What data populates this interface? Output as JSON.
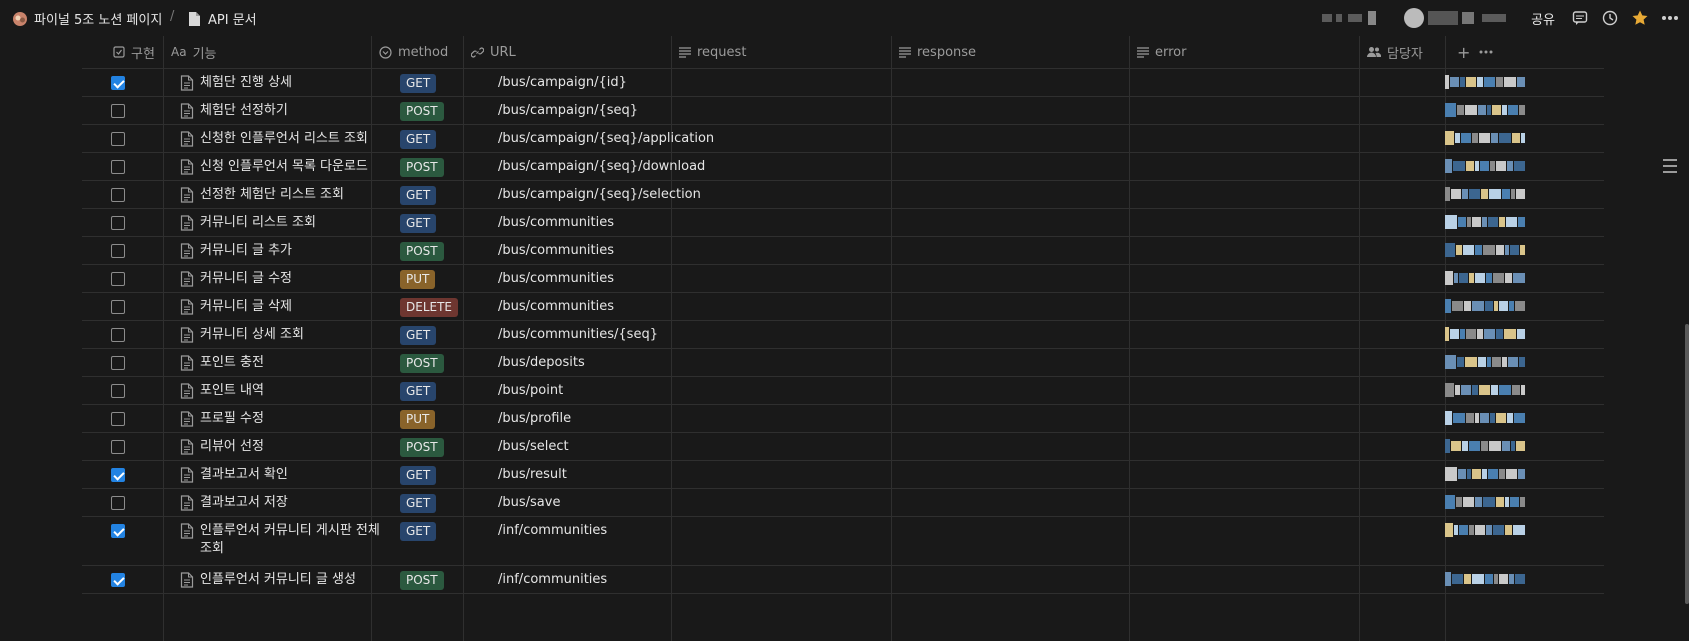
{
  "breadcrumb": {
    "workspace": "파이널 5조 노션 페이지",
    "separator": "/",
    "page": "API 문서"
  },
  "topbar": {
    "share_label": "공유"
  },
  "columns": {
    "done": "구현",
    "feature": "기능",
    "method": "method",
    "url": "URL",
    "request": "request",
    "response": "response",
    "error": "error",
    "assignee": "담당자"
  },
  "colors": {
    "GET": "#28456c",
    "POST": "#2b593f",
    "PUT": "#89632a",
    "DELETE": "#6e3630",
    "checkbox": "#2383e2"
  },
  "rows": [
    {
      "done": true,
      "name": "체험단 진행 상세",
      "method": "GET",
      "url": "/bus/campaign/{id}"
    },
    {
      "done": false,
      "name": "체험단 선정하기",
      "method": "POST",
      "url": "/bus/campaign/{seq}"
    },
    {
      "done": false,
      "name": "신청한 인플루언서 리스트 조회",
      "method": "GET",
      "url": "/bus/campaign/{seq}/application"
    },
    {
      "done": false,
      "name": "신청 인플루언서 목록 다운로드",
      "method": "POST",
      "url": "/bus/campaign/{seq}/download"
    },
    {
      "done": false,
      "name": "선정한 체험단 리스트 조회",
      "method": "GET",
      "url": "/bus/campaign/{seq}/selection"
    },
    {
      "done": false,
      "name": "커뮤니티 리스트 조회",
      "method": "GET",
      "url": "/bus/communities"
    },
    {
      "done": false,
      "name": "커뮤니티 글 추가",
      "method": "POST",
      "url": "/bus/communities"
    },
    {
      "done": false,
      "name": "커뮤니티 글 수정",
      "method": "PUT",
      "url": "/bus/communities"
    },
    {
      "done": false,
      "name": "커뮤니티 글 삭제",
      "method": "DELETE",
      "url": "/bus/communities"
    },
    {
      "done": false,
      "name": "커뮤니티 상세 조회",
      "method": "GET",
      "url": "/bus/communities/{seq}"
    },
    {
      "done": false,
      "name": "포인트 충전",
      "method": "POST",
      "url": "/bus/deposits"
    },
    {
      "done": false,
      "name": "포인트 내역",
      "method": "GET",
      "url": "/bus/point"
    },
    {
      "done": false,
      "name": "프로필 수정",
      "method": "PUT",
      "url": "/bus/profile"
    },
    {
      "done": false,
      "name": "리뷰어 선정",
      "method": "POST",
      "url": "/bus/select"
    },
    {
      "done": true,
      "name": "결과보고서 확인",
      "method": "GET",
      "url": "/bus/result"
    },
    {
      "done": false,
      "name": "결과보고서 저장",
      "method": "GET",
      "url": "/bus/save"
    },
    {
      "done": true,
      "name": "인플루언서 커뮤니티 게시판 전체 조회",
      "method": "GET",
      "url": "/inf/communities"
    },
    {
      "done": true,
      "name": "인플루언서 커뮤니티 글 생성",
      "method": "POST",
      "url": "/inf/communities"
    }
  ]
}
